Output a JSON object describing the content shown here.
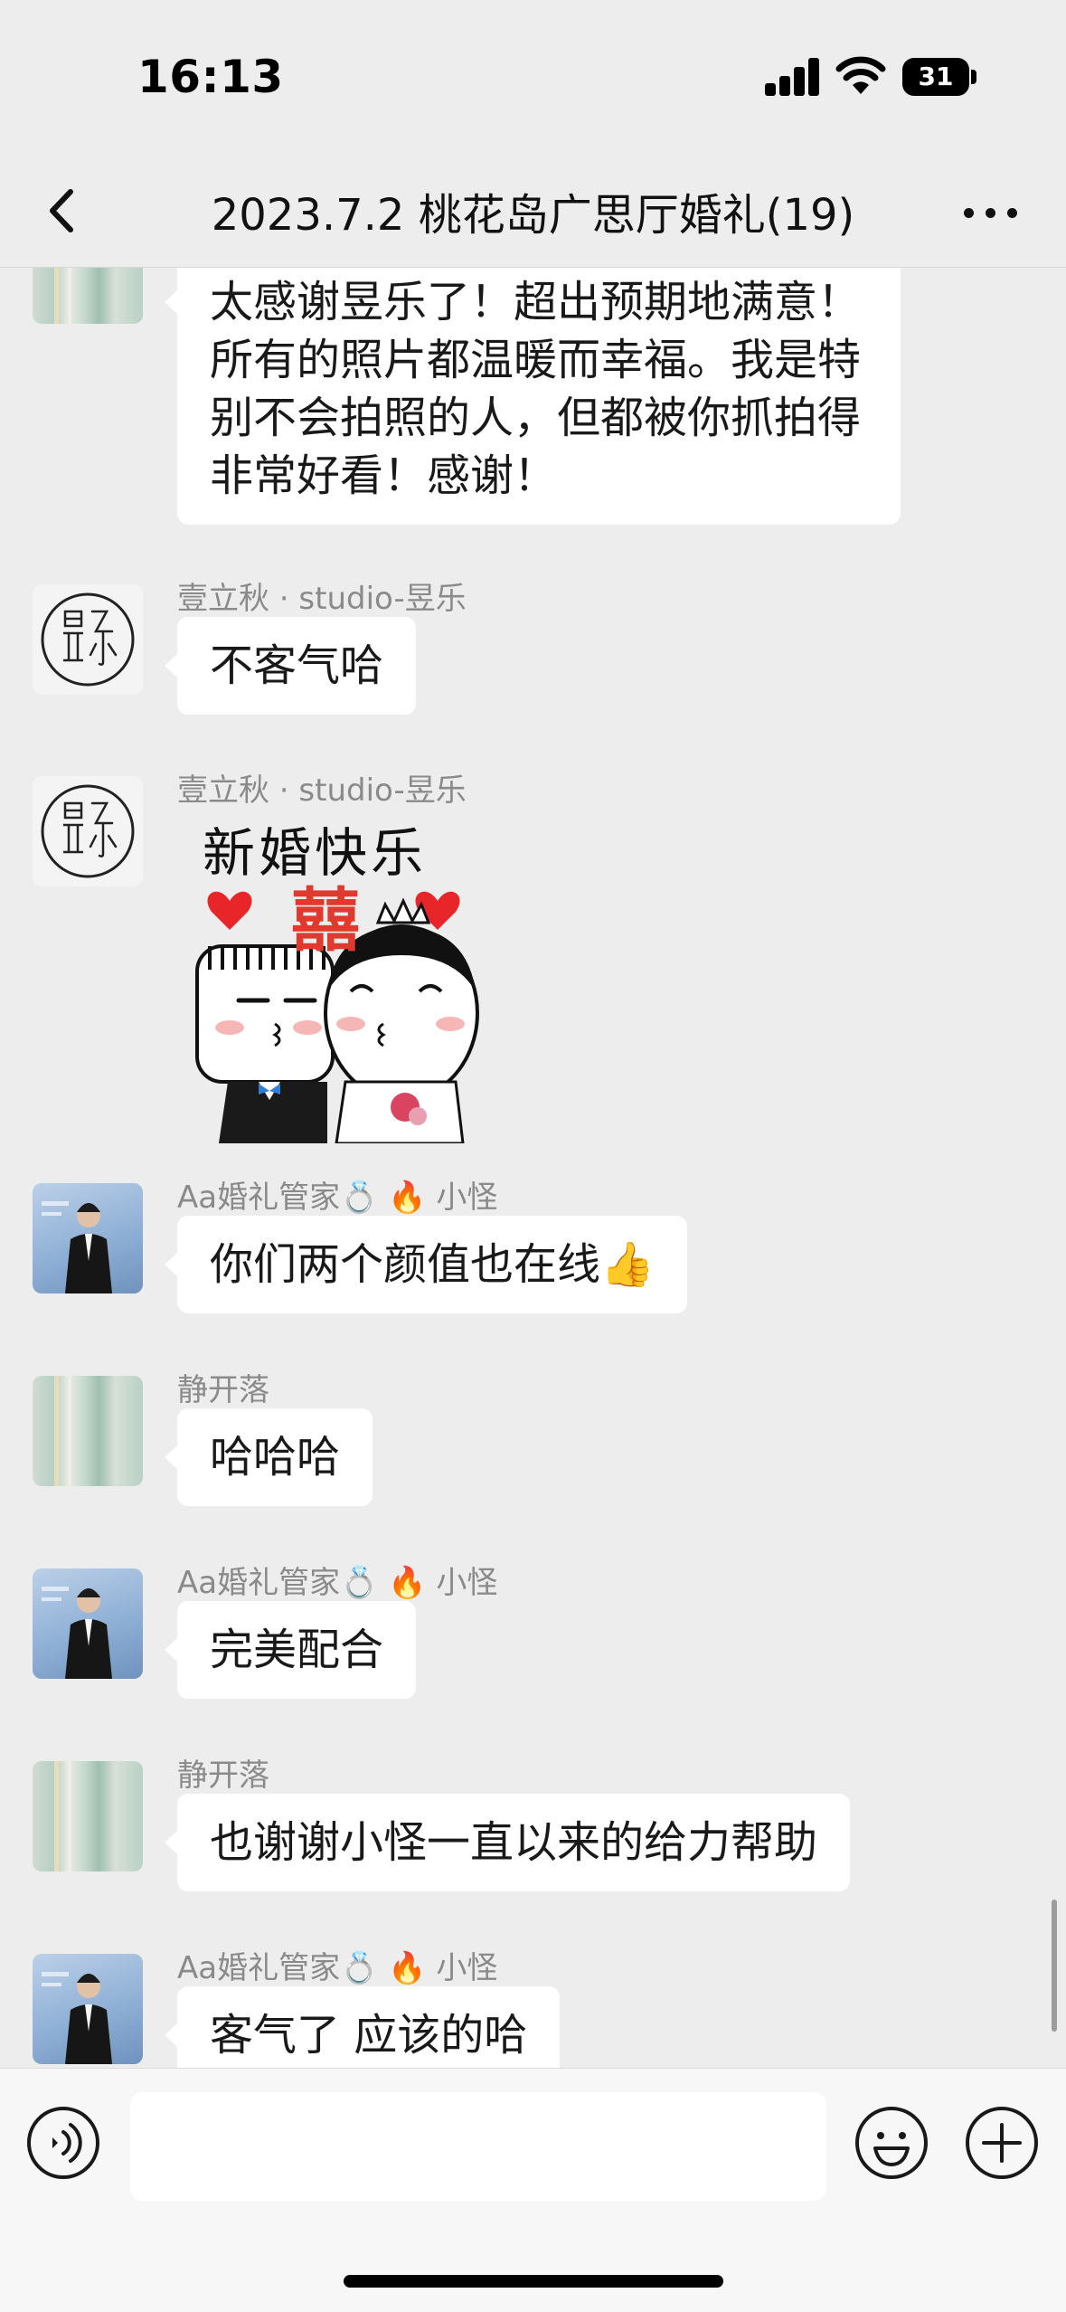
{
  "status_bar": {
    "time": "16:13",
    "battery": "31",
    "icons": [
      "signal-icon",
      "wifi-icon",
      "battery-icon"
    ]
  },
  "nav": {
    "title": "2023.7.2 桃花岛广思厅婚礼(19)",
    "icons": [
      "back-chevron-icon",
      "more-dots-icon"
    ]
  },
  "messages": [
    {
      "sender": "",
      "avatar": "avatar-jing",
      "type": "text",
      "text": "太感谢昱乐了！超出预期地满意！所有的照片都温暖而幸福。我是特别不会拍照的人，但都被你抓拍得非常好看！感谢！"
    },
    {
      "sender": "壹立秋 · studio-昱乐",
      "avatar": "avatar-studio",
      "type": "text",
      "text": "不客气哈"
    },
    {
      "sender": "壹立秋 · studio-昱乐",
      "avatar": "avatar-studio",
      "type": "sticker",
      "sticker_text": "新婚快乐",
      "sticker_glyph": "囍"
    },
    {
      "sender": "Aa婚礼管家💍 🔥 小怪",
      "avatar": "avatar-aa",
      "type": "text",
      "text": "你们两个颜值也在线👍"
    },
    {
      "sender": "静开落",
      "avatar": "avatar-jing",
      "type": "text",
      "text": "哈哈哈"
    },
    {
      "sender": "Aa婚礼管家💍 🔥 小怪",
      "avatar": "avatar-aa",
      "type": "text",
      "text": "完美配合"
    },
    {
      "sender": "静开落",
      "avatar": "avatar-jing",
      "type": "text",
      "text": "也谢谢小怪一直以来的给力帮助"
    },
    {
      "sender": "Aa婚礼管家💍 🔥 小怪",
      "avatar": "avatar-aa",
      "type": "text",
      "text": "客气了 应该的哈"
    }
  ],
  "input_bar": {
    "value": "",
    "icons": [
      "voice-icon",
      "emoji-icon",
      "plus-icon"
    ]
  },
  "colors": {
    "background": "#ededed",
    "bubble": "#ffffff",
    "sender_name": "#8a8a8a",
    "heart": "#e8262a",
    "xi_red": "#e03a2f"
  }
}
